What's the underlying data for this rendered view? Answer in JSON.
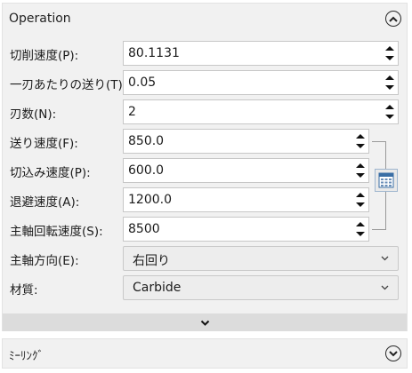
{
  "operation_panel": {
    "title": "Operation",
    "collapse_icon": "chevron-up-circle-icon",
    "fields": [
      {
        "label": "切削速度(P):",
        "value": "80.1131",
        "type": "spin"
      },
      {
        "label": "一刃あたりの送り(T):",
        "value": "0.05",
        "type": "spin"
      },
      {
        "label": "刃数(N):",
        "value": "2",
        "type": "spin"
      },
      {
        "label": "送り速度(F):",
        "value": "850.0",
        "type": "spin"
      },
      {
        "label": "切込み速度(P):",
        "value": "600.0",
        "type": "spin"
      },
      {
        "label": "退避速度(A):",
        "value": "1200.0",
        "type": "spin"
      },
      {
        "label": "主軸回転速度(S):",
        "value": "8500",
        "type": "spin"
      },
      {
        "label": "主軸方向(E):",
        "value": "右回り",
        "type": "combo"
      },
      {
        "label": "材質:",
        "value": "Carbide",
        "type": "combo"
      }
    ],
    "calculator_icon": "calculator-icon",
    "expand_icon": "chevron-down-icon"
  },
  "milling_panel": {
    "title": "ﾐｰﾘﾝｸﾞ",
    "expand_icon": "chevron-down-circle-icon"
  }
}
